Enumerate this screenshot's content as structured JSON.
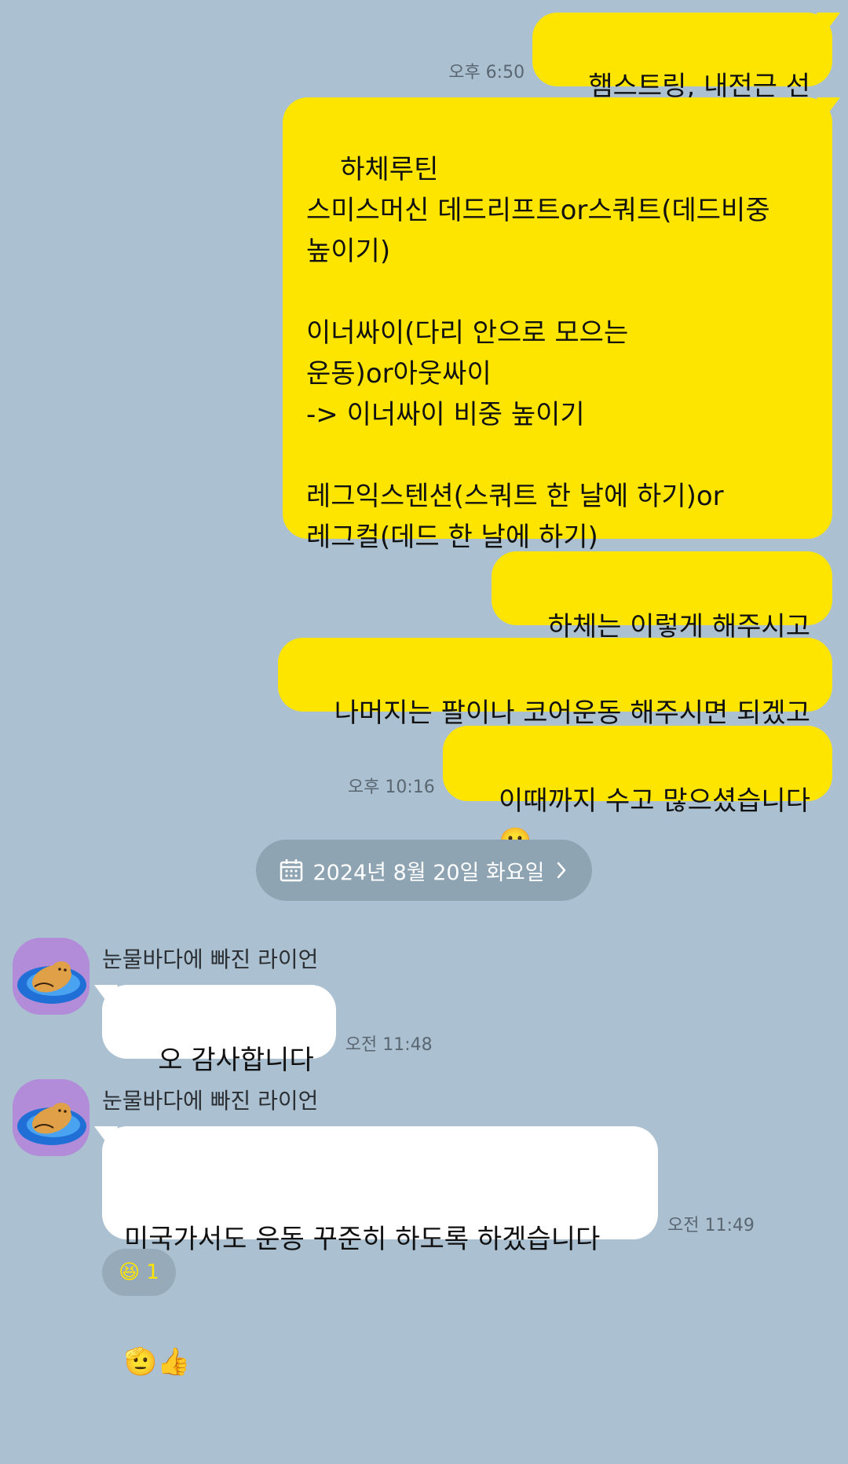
{
  "outgoing": [
    {
      "text": "햄스트링, 내전근 선",
      "time": "오후 6:50"
    },
    {
      "text": "하체루틴\n스미스머신 데드리프트or스쿼트(데드비중\n높이기)\n\n이너싸이(다리 안으로 모으는\n운동)or아웃싸이\n-> 이너싸이 비중 높이기\n\n레그익스텐션(스쿼트 한 날에 하기)or\n레그컬(데드 한 날에 하기)"
    },
    {
      "text": "하체는 이렇게 해주시고"
    },
    {
      "text": "나머지는 팔이나 코어운동 해주시면 되겠고"
    },
    {
      "text": "이때까지 수고 많으셨습니다",
      "emoji": "🙂",
      "time": "오후 10:16"
    }
  ],
  "date_divider": {
    "label": "2024년 8월 20일 화요일"
  },
  "incoming": [
    {
      "sender": "눈물바다에 빠진 라이언",
      "text": "오 감사합니다",
      "time": "오전 11:48"
    },
    {
      "sender": "눈물바다에 빠진 라이언",
      "text": "미국가서도 운동 꾸준히 하도록 하겠습니다",
      "emoji": "🫡👍",
      "time": "오전 11:49"
    }
  ],
  "reaction": {
    "emoji": "😆",
    "count": "1"
  },
  "colors": {
    "background": "#abc1d1",
    "outgoing_bubble": "#fee500",
    "incoming_bubble": "#ffffff"
  }
}
